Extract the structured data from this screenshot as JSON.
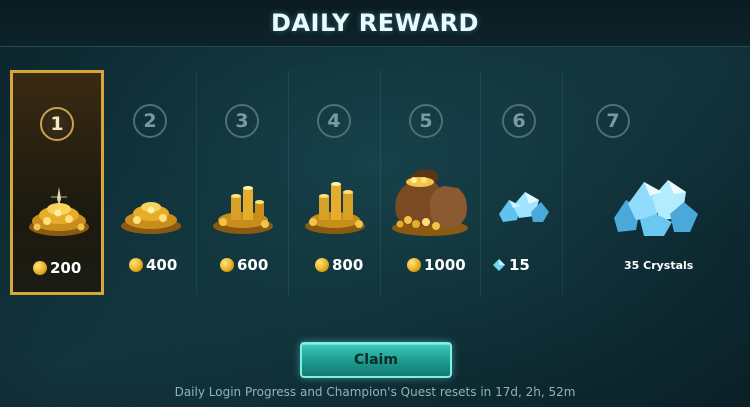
{
  "title": "DAILY REWARD",
  "days": [
    {
      "number": "1",
      "amount": "200",
      "currency": "coin-icon",
      "selected": true
    },
    {
      "number": "2",
      "amount": "400",
      "currency": "coin-icon",
      "selected": false
    },
    {
      "number": "3",
      "amount": "600",
      "currency": "coin-icon",
      "selected": false
    },
    {
      "number": "4",
      "amount": "800",
      "currency": "coin-icon",
      "selected": false
    },
    {
      "number": "5",
      "amount": "1000",
      "currency": "coin-icon",
      "selected": false
    },
    {
      "number": "6",
      "amount": "15",
      "currency": "crystal-icon",
      "selected": false
    },
    {
      "number": "7",
      "amount": "35 Crystals",
      "currency": "crystal-icon",
      "selected": false
    }
  ],
  "claim_label": "Claim",
  "footer_text": "Daily Login Progress and Champion's Quest resets in 17d, 2h, 52m",
  "colors": {
    "selected_border": "#d8a73a",
    "claim_button": "#2ab3a5",
    "background": "#0f2e36",
    "title_text": "#e8fbff"
  }
}
